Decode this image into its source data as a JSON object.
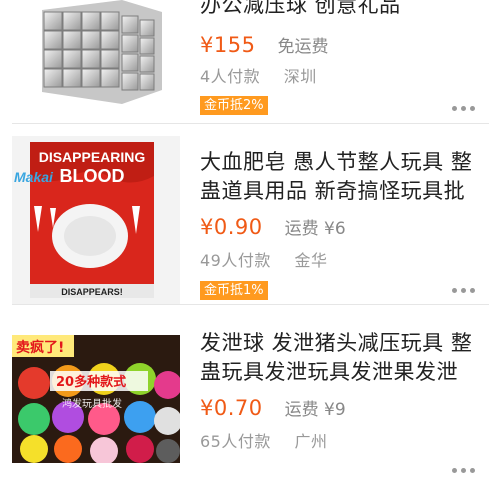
{
  "products": [
    {
      "title": "办公减压球 创意礼品",
      "price": "¥155",
      "shipping": "免运费",
      "sold": "4人付款",
      "location": "深圳",
      "tag": "金币抵2%",
      "image": "neodymium-magnet-cube"
    },
    {
      "title": "大血肥皂 愚人节整人玩具 整蛊道具用品 新奇搞怪玩具批",
      "price": "¥0.90",
      "shipping": "运费 ¥6",
      "sold": "49人付款",
      "location": "金华",
      "tag": "金币抵1%",
      "image_text": {
        "brand": "Makai",
        "line1": "DISAPPEARING",
        "line2": "BLOOD",
        "bottom": "DISAPPEARS!"
      }
    },
    {
      "title": "发泄球 发泄猪头减压玩具 整蛊玩具发泄玩具发泄果发泄",
      "price": "¥0.70",
      "shipping": "运费 ¥9",
      "sold": "65人付款",
      "location": "广州",
      "image_text": {
        "banner": "卖疯了!",
        "subbanner": "20多种款式",
        "watermark": "鸿发玩具批发"
      }
    }
  ],
  "colors": {
    "price": "#f05a16",
    "tag": "#ff9a1f"
  }
}
